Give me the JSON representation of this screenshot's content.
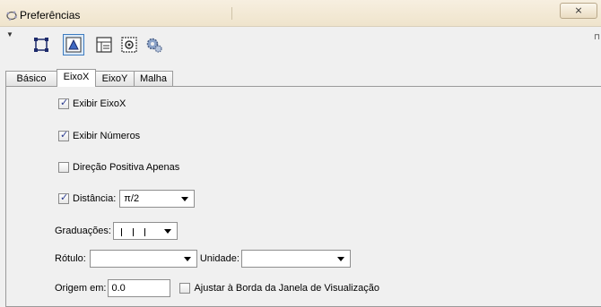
{
  "window": {
    "title": "Preferências",
    "close_symbol": "⨯"
  },
  "toolbar": {
    "buttons": [
      {
        "icon": "graphics-icon",
        "selected": false
      },
      {
        "icon": "graphics-view-icon",
        "selected": true
      },
      {
        "icon": "algebra-view-icon",
        "selected": false
      },
      {
        "icon": "defaults-icon",
        "selected": false
      },
      {
        "icon": "advanced-settings-icon",
        "selected": false
      }
    ]
  },
  "tabs": [
    "Básico",
    "EixoX",
    "EixoY",
    "Malha"
  ],
  "active_tab": "EixoX",
  "options": {
    "show_axis": {
      "label": "Exibir EixoX",
      "checked": true
    },
    "show_numbers": {
      "label": "Exibir Números",
      "checked": true
    },
    "positive_only": {
      "label": "Direção Positiva Apenas",
      "checked": false
    },
    "distance": {
      "label": "Distância:",
      "checked": true,
      "value": "π/2"
    },
    "ticks": {
      "label": "Graduações:"
    },
    "label": {
      "label": "Rótulo:",
      "value": ""
    },
    "unit": {
      "label": "Unidade:",
      "value": ""
    },
    "origin": {
      "label": "Origem em:",
      "value": "0.0"
    },
    "snap_to_border": {
      "label": "Ajustar à Borda da Janela de Visualização",
      "checked": false
    }
  },
  "colors": {
    "selection_border": "#3d7bbf",
    "checkmark": "#2b3b8f"
  }
}
